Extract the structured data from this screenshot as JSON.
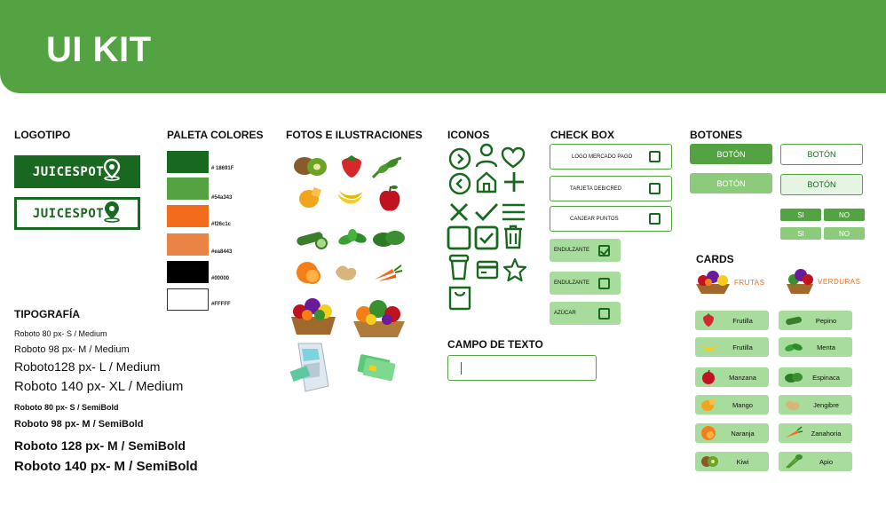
{
  "header": {
    "title": "UI KIT",
    "bg_color": "#54a343"
  },
  "sections": {
    "logo": "LOGOTIPO",
    "palette": "PALETA COLORES",
    "photos": "FOTOS  E ILUSTRACIONES",
    "icons": "ICONOS",
    "checkbox": "CHECK BOX",
    "buttons": "BOTONES",
    "typography": "TIPOGRAFÍA",
    "textfield": "CAMPO DE TEXTO",
    "cards": "CARDS"
  },
  "logo": {
    "text": "JUICESPOT",
    "icon": "map-pin-icon"
  },
  "palette": [
    {
      "color": "#18691f",
      "label": "# 18691F"
    },
    {
      "color": "#54a343",
      "label": "#54a343"
    },
    {
      "color": "#f26c1c",
      "label": "#f26c1c"
    },
    {
      "color": "#ea8443",
      "label": "#ea8443"
    },
    {
      "color": "#000000",
      "label": "#00000"
    },
    {
      "color": "#ffffff",
      "label": "#FFFFF"
    }
  ],
  "typography": [
    "Roboto 80 px- S / Medium",
    "Roboto 98 px- M / Medium",
    "Roboto128 px- L / Medium",
    "Roboto 140 px- XL / Medium",
    "Roboto 80 px- S / SemiBold",
    "Roboto 98 px- M / SemiBold",
    "Roboto 128 px- M / SemiBold",
    "Roboto 140 px- M / SemiBold"
  ],
  "photos": [
    "kiwi",
    "strawberry",
    "arugula",
    "mango",
    "banana",
    "apple",
    "cucumber",
    "mint",
    "spinach",
    "orange",
    "ginger",
    "carrot",
    "fruit-basket",
    "fruit-basket",
    "card-terminal",
    "credit-cards"
  ],
  "icons": [
    "chevron-right-circle-icon",
    "user-icon",
    "heart-icon",
    "chevron-left-circle-icon",
    "home-icon",
    "plus-icon",
    "close-icon",
    "check-icon",
    "menu-icon",
    "square-icon",
    "checked-square-icon",
    "trash-icon",
    "cup-icon",
    "credit-card-icon",
    "star-icon",
    "bag-icon"
  ],
  "checkboxes": [
    {
      "label": "LOGO MERCADO PAGO",
      "checked": false,
      "style": "outline"
    },
    {
      "label": "TARJETA DEB/CRED",
      "checked": false,
      "style": "outline"
    },
    {
      "label": "CANJEAR PUNTOS",
      "checked": false,
      "style": "outline"
    },
    {
      "label": "ENDULZANTE",
      "checked": true,
      "style": "filled"
    },
    {
      "label": "ENDULZANTE",
      "checked": false,
      "style": "filled"
    },
    {
      "label": "AZÚCAR",
      "checked": false,
      "style": "filled"
    }
  ],
  "buttons": {
    "boton": "BOTÓN",
    "si": "SI",
    "no": "NO"
  },
  "cards": {
    "frutas": "FRUTAS",
    "verduras": "VERDURAS",
    "left": [
      {
        "label": "Frutilla",
        "icon": "strawberry-icon"
      },
      {
        "label": "Frutilla",
        "icon": "banana-icon"
      },
      {
        "label": "Manzana",
        "icon": "apple-icon"
      },
      {
        "label": "Mango",
        "icon": "mango-icon"
      },
      {
        "label": "Naranja",
        "icon": "orange-icon"
      },
      {
        "label": "Kiwi",
        "icon": "kiwi-icon"
      }
    ],
    "right": [
      {
        "label": "Pepino",
        "icon": "cucumber-icon"
      },
      {
        "label": "Menta",
        "icon": "mint-icon"
      },
      {
        "label": "Espinaca",
        "icon": "spinach-icon"
      },
      {
        "label": "Jengibre",
        "icon": "ginger-icon"
      },
      {
        "label": "Zanahoria",
        "icon": "carrot-icon"
      },
      {
        "label": "Apio",
        "icon": "celery-icon"
      }
    ]
  }
}
